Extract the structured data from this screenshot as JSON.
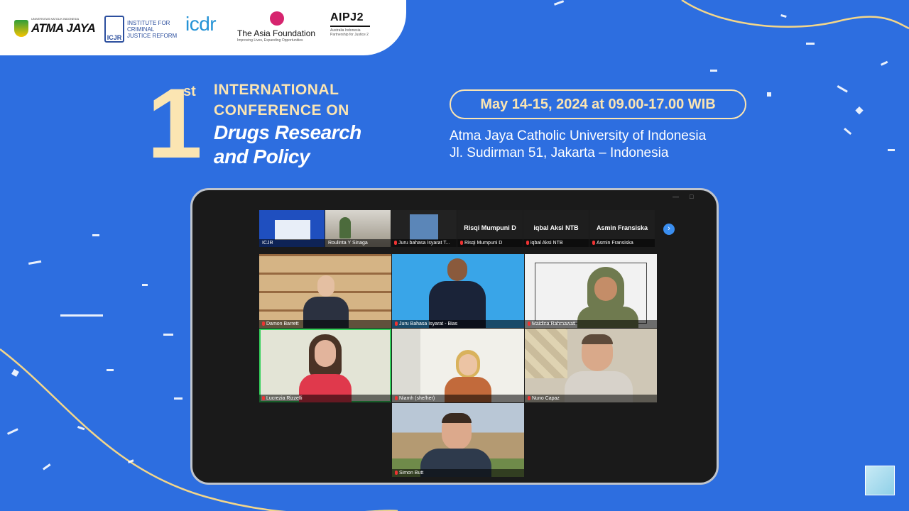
{
  "colors": {
    "background": "#2d6ee0",
    "accent": "#fbe5b2",
    "tile_border_active": "#33d15b"
  },
  "logos": {
    "atma_jaya": {
      "top": "UNIVERSITAS KATOLIK INDONESIA",
      "name": "ATMA JAYA"
    },
    "icjr": {
      "mark": "ICJR",
      "name": "INSTITUTE FOR CRIMINAL JUSTICE REFORM"
    },
    "icdr": {
      "name": "icdr"
    },
    "asia_foundation": {
      "name": "The Asia Foundation",
      "tagline": "Improving Lives, Expanding Opportunities"
    },
    "aipj2": {
      "name": "AIPJ2",
      "tagline": "Australia Indonesia Partnership for Justice 2"
    }
  },
  "conference": {
    "ordinal_number": "1",
    "ordinal_suffix": "st",
    "line1": "INTERNATIONAL",
    "line2": "CONFERENCE ON",
    "line3": "Drugs Research",
    "line4": "and Policy"
  },
  "event": {
    "date": "May 14-15, 2024 at 09.00-17.00 WIB",
    "venue_line1": "Atma Jaya Catholic University of Indonesia",
    "venue_line2": "Jl. Sudirman 51, Jakarta – Indonesia"
  },
  "meeting": {
    "strip": [
      {
        "label": "ICJR",
        "name": ""
      },
      {
        "label": "Roulinta Y Sinaga",
        "name": ""
      },
      {
        "label": "Juru bahasa Isyarat T...",
        "name": ""
      },
      {
        "label": "Risqi Mumpuni D",
        "name": "Risqi Mumpuni D"
      },
      {
        "label": "iqbal Aksi NTB",
        "name": "iqbal Aksi NTB"
      },
      {
        "label": "Asmin Fransiska",
        "name": "Asmin Fransiska"
      }
    ],
    "tiles": [
      {
        "label": "Damon Barrett"
      },
      {
        "label": "Juru Bahasa Isyarat - Bias"
      },
      {
        "label": "Maidina Rahmawati"
      },
      {
        "label": "Lucrezia Rizzelli"
      },
      {
        "label": "Niamh (she/her)"
      },
      {
        "label": "Nuno Capaz"
      },
      {
        "label": "Simon Butt"
      }
    ]
  }
}
